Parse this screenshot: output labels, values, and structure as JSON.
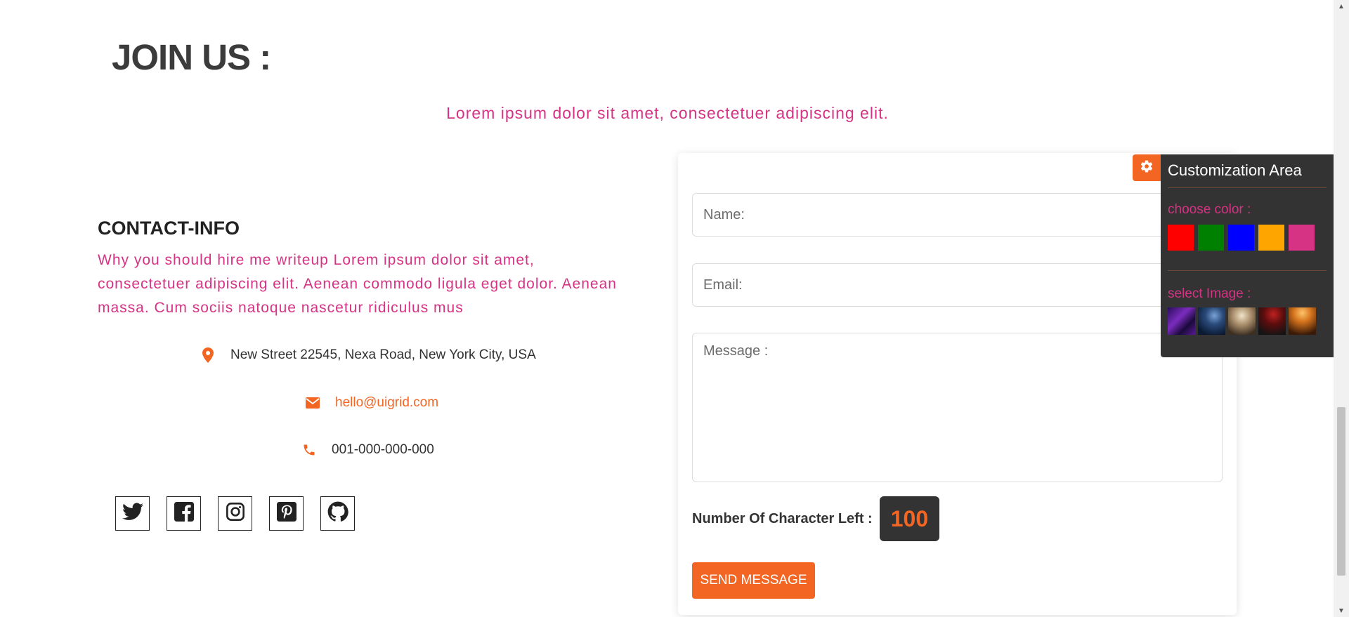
{
  "section": {
    "title": "JOIN US :",
    "subtitle": "Lorem ipsum dolor sit amet, consectetuer adipiscing elit."
  },
  "contact": {
    "heading": "CONTACT-INFO",
    "description": "Why you should hire me writeup Lorem ipsum dolor sit amet, consectetuer adipiscing elit. Aenean commodo ligula eget dolor. Aenean massa. Cum sociis natoque nascetur ridiculus mus",
    "address": "New Street 22545, Nexa Road, New York City, USA",
    "email": "hello@uigrid.com",
    "phone": "001-000-000-000",
    "socials": [
      {
        "icon": "twitter-icon"
      },
      {
        "icon": "facebook-icon"
      },
      {
        "icon": "instagram-icon"
      },
      {
        "icon": "pinterest-icon"
      },
      {
        "icon": "github-icon"
      }
    ]
  },
  "form": {
    "name_placeholder": "Name:",
    "email_placeholder": "Email:",
    "message_placeholder": "Message :",
    "char_label": "Number Of Character Left :",
    "char_count": "100",
    "send_label": "SEND MESSAGE"
  },
  "customization": {
    "title": "Customization Area",
    "color_label": "choose color :",
    "colors": [
      "#ff0000",
      "#008000",
      "#0000ff",
      "#ffa500",
      "#d63384"
    ],
    "image_label": "select Image :",
    "image_count": 5
  },
  "theme": {
    "accent": "#f26522",
    "pink": "#d63384",
    "dark": "#333333"
  }
}
